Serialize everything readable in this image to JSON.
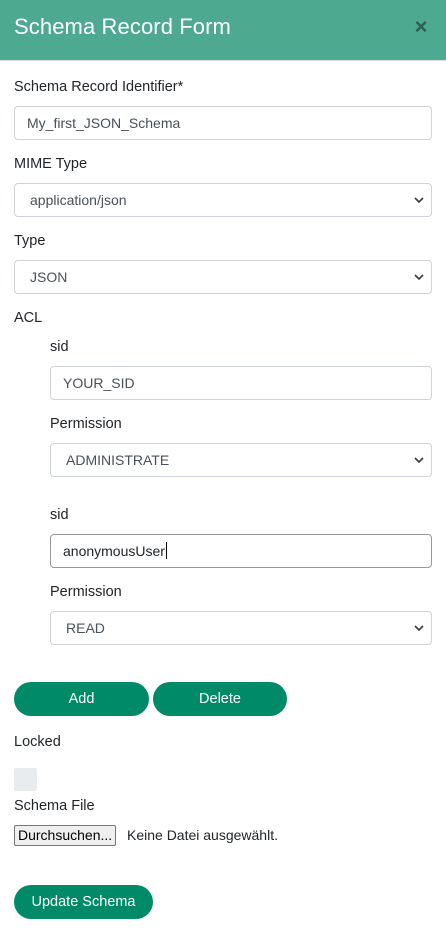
{
  "header": {
    "title": "Schema Record Form",
    "close_label": "×"
  },
  "form": {
    "identifier": {
      "label": "Schema Record Identifier*",
      "value": "My_first_JSON_Schema"
    },
    "mime_type": {
      "label": "MIME Type",
      "selected": "application/json"
    },
    "type": {
      "label": "Type",
      "selected": "JSON"
    },
    "acl": {
      "label": "ACL",
      "entries": [
        {
          "sid_label": "sid",
          "sid_value": "YOUR_SID",
          "permission_label": "Permission",
          "permission_selected": "ADMINISTRATE"
        },
        {
          "sid_label": "sid",
          "sid_value": "anonymousUser",
          "permission_label": "Permission",
          "permission_selected": "READ"
        }
      ],
      "add_label": "Add",
      "delete_label": "Delete"
    },
    "locked": {
      "label": "Locked",
      "checked": false
    },
    "schema_file": {
      "label": "Schema File",
      "button_label": "Durchsuchen...",
      "status_text": "Keine Datei ausgewählt."
    },
    "submit_label": "Update Schema"
  },
  "colors": {
    "header_bg": "#4daa91",
    "button_bg": "#018a67"
  }
}
